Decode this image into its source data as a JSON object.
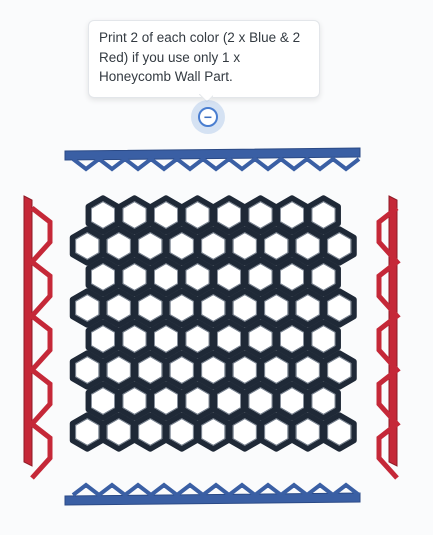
{
  "annotation": {
    "text": "Print 2 of each color (2 x Blue & 2\n Red) if you use only 1 x\nHoneycomb Wall Part.",
    "toggle_symbol": "−"
  },
  "colors": {
    "blue_part": "#3a5fa4",
    "blue_dark": "#2b4a86",
    "red_part": "#c52838",
    "red_dark": "#8e1a26",
    "honeycomb": "#1f2937",
    "honeycomb_light": "#6b7685",
    "accent": "#4a7ed0"
  },
  "icons": {
    "toggle": "minus-circle-icon"
  }
}
